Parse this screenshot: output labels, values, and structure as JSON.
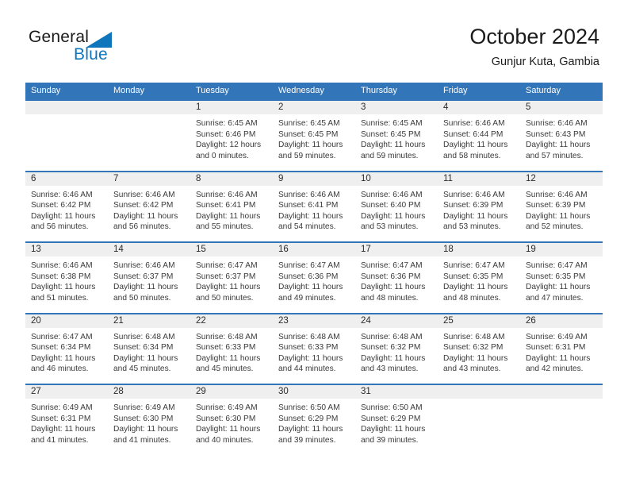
{
  "brand": {
    "name_part1": "General",
    "name_part2": "Blue",
    "triangle_color": "#0f76bc"
  },
  "header": {
    "title": "October 2024",
    "subtitle": "Gunjur Kuta, Gambia",
    "accent_color": "#3275b8",
    "day_band_color": "#efefef"
  },
  "weekday_headers": [
    "Sunday",
    "Monday",
    "Tuesday",
    "Wednesday",
    "Thursday",
    "Friday",
    "Saturday"
  ],
  "weeks": [
    [
      {
        "day": "",
        "sunrise": "",
        "sunset": "",
        "daylight1": "",
        "daylight2": ""
      },
      {
        "day": "",
        "sunrise": "",
        "sunset": "",
        "daylight1": "",
        "daylight2": ""
      },
      {
        "day": "1",
        "sunrise": "Sunrise: 6:45 AM",
        "sunset": "Sunset: 6:46 PM",
        "daylight1": "Daylight: 12 hours",
        "daylight2": "and 0 minutes."
      },
      {
        "day": "2",
        "sunrise": "Sunrise: 6:45 AM",
        "sunset": "Sunset: 6:45 PM",
        "daylight1": "Daylight: 11 hours",
        "daylight2": "and 59 minutes."
      },
      {
        "day": "3",
        "sunrise": "Sunrise: 6:45 AM",
        "sunset": "Sunset: 6:45 PM",
        "daylight1": "Daylight: 11 hours",
        "daylight2": "and 59 minutes."
      },
      {
        "day": "4",
        "sunrise": "Sunrise: 6:46 AM",
        "sunset": "Sunset: 6:44 PM",
        "daylight1": "Daylight: 11 hours",
        "daylight2": "and 58 minutes."
      },
      {
        "day": "5",
        "sunrise": "Sunrise: 6:46 AM",
        "sunset": "Sunset: 6:43 PM",
        "daylight1": "Daylight: 11 hours",
        "daylight2": "and 57 minutes."
      }
    ],
    [
      {
        "day": "6",
        "sunrise": "Sunrise: 6:46 AM",
        "sunset": "Sunset: 6:42 PM",
        "daylight1": "Daylight: 11 hours",
        "daylight2": "and 56 minutes."
      },
      {
        "day": "7",
        "sunrise": "Sunrise: 6:46 AM",
        "sunset": "Sunset: 6:42 PM",
        "daylight1": "Daylight: 11 hours",
        "daylight2": "and 56 minutes."
      },
      {
        "day": "8",
        "sunrise": "Sunrise: 6:46 AM",
        "sunset": "Sunset: 6:41 PM",
        "daylight1": "Daylight: 11 hours",
        "daylight2": "and 55 minutes."
      },
      {
        "day": "9",
        "sunrise": "Sunrise: 6:46 AM",
        "sunset": "Sunset: 6:41 PM",
        "daylight1": "Daylight: 11 hours",
        "daylight2": "and 54 minutes."
      },
      {
        "day": "10",
        "sunrise": "Sunrise: 6:46 AM",
        "sunset": "Sunset: 6:40 PM",
        "daylight1": "Daylight: 11 hours",
        "daylight2": "and 53 minutes."
      },
      {
        "day": "11",
        "sunrise": "Sunrise: 6:46 AM",
        "sunset": "Sunset: 6:39 PM",
        "daylight1": "Daylight: 11 hours",
        "daylight2": "and 53 minutes."
      },
      {
        "day": "12",
        "sunrise": "Sunrise: 6:46 AM",
        "sunset": "Sunset: 6:39 PM",
        "daylight1": "Daylight: 11 hours",
        "daylight2": "and 52 minutes."
      }
    ],
    [
      {
        "day": "13",
        "sunrise": "Sunrise: 6:46 AM",
        "sunset": "Sunset: 6:38 PM",
        "daylight1": "Daylight: 11 hours",
        "daylight2": "and 51 minutes."
      },
      {
        "day": "14",
        "sunrise": "Sunrise: 6:46 AM",
        "sunset": "Sunset: 6:37 PM",
        "daylight1": "Daylight: 11 hours",
        "daylight2": "and 50 minutes."
      },
      {
        "day": "15",
        "sunrise": "Sunrise: 6:47 AM",
        "sunset": "Sunset: 6:37 PM",
        "daylight1": "Daylight: 11 hours",
        "daylight2": "and 50 minutes."
      },
      {
        "day": "16",
        "sunrise": "Sunrise: 6:47 AM",
        "sunset": "Sunset: 6:36 PM",
        "daylight1": "Daylight: 11 hours",
        "daylight2": "and 49 minutes."
      },
      {
        "day": "17",
        "sunrise": "Sunrise: 6:47 AM",
        "sunset": "Sunset: 6:36 PM",
        "daylight1": "Daylight: 11 hours",
        "daylight2": "and 48 minutes."
      },
      {
        "day": "18",
        "sunrise": "Sunrise: 6:47 AM",
        "sunset": "Sunset: 6:35 PM",
        "daylight1": "Daylight: 11 hours",
        "daylight2": "and 48 minutes."
      },
      {
        "day": "19",
        "sunrise": "Sunrise: 6:47 AM",
        "sunset": "Sunset: 6:35 PM",
        "daylight1": "Daylight: 11 hours",
        "daylight2": "and 47 minutes."
      }
    ],
    [
      {
        "day": "20",
        "sunrise": "Sunrise: 6:47 AM",
        "sunset": "Sunset: 6:34 PM",
        "daylight1": "Daylight: 11 hours",
        "daylight2": "and 46 minutes."
      },
      {
        "day": "21",
        "sunrise": "Sunrise: 6:48 AM",
        "sunset": "Sunset: 6:34 PM",
        "daylight1": "Daylight: 11 hours",
        "daylight2": "and 45 minutes."
      },
      {
        "day": "22",
        "sunrise": "Sunrise: 6:48 AM",
        "sunset": "Sunset: 6:33 PM",
        "daylight1": "Daylight: 11 hours",
        "daylight2": "and 45 minutes."
      },
      {
        "day": "23",
        "sunrise": "Sunrise: 6:48 AM",
        "sunset": "Sunset: 6:33 PM",
        "daylight1": "Daylight: 11 hours",
        "daylight2": "and 44 minutes."
      },
      {
        "day": "24",
        "sunrise": "Sunrise: 6:48 AM",
        "sunset": "Sunset: 6:32 PM",
        "daylight1": "Daylight: 11 hours",
        "daylight2": "and 43 minutes."
      },
      {
        "day": "25",
        "sunrise": "Sunrise: 6:48 AM",
        "sunset": "Sunset: 6:32 PM",
        "daylight1": "Daylight: 11 hours",
        "daylight2": "and 43 minutes."
      },
      {
        "day": "26",
        "sunrise": "Sunrise: 6:49 AM",
        "sunset": "Sunset: 6:31 PM",
        "daylight1": "Daylight: 11 hours",
        "daylight2": "and 42 minutes."
      }
    ],
    [
      {
        "day": "27",
        "sunrise": "Sunrise: 6:49 AM",
        "sunset": "Sunset: 6:31 PM",
        "daylight1": "Daylight: 11 hours",
        "daylight2": "and 41 minutes."
      },
      {
        "day": "28",
        "sunrise": "Sunrise: 6:49 AM",
        "sunset": "Sunset: 6:30 PM",
        "daylight1": "Daylight: 11 hours",
        "daylight2": "and 41 minutes."
      },
      {
        "day": "29",
        "sunrise": "Sunrise: 6:49 AM",
        "sunset": "Sunset: 6:30 PM",
        "daylight1": "Daylight: 11 hours",
        "daylight2": "and 40 minutes."
      },
      {
        "day": "30",
        "sunrise": "Sunrise: 6:50 AM",
        "sunset": "Sunset: 6:29 PM",
        "daylight1": "Daylight: 11 hours",
        "daylight2": "and 39 minutes."
      },
      {
        "day": "31",
        "sunrise": "Sunrise: 6:50 AM",
        "sunset": "Sunset: 6:29 PM",
        "daylight1": "Daylight: 11 hours",
        "daylight2": "and 39 minutes."
      },
      {
        "day": "",
        "sunrise": "",
        "sunset": "",
        "daylight1": "",
        "daylight2": ""
      },
      {
        "day": "",
        "sunrise": "",
        "sunset": "",
        "daylight1": "",
        "daylight2": ""
      }
    ]
  ]
}
